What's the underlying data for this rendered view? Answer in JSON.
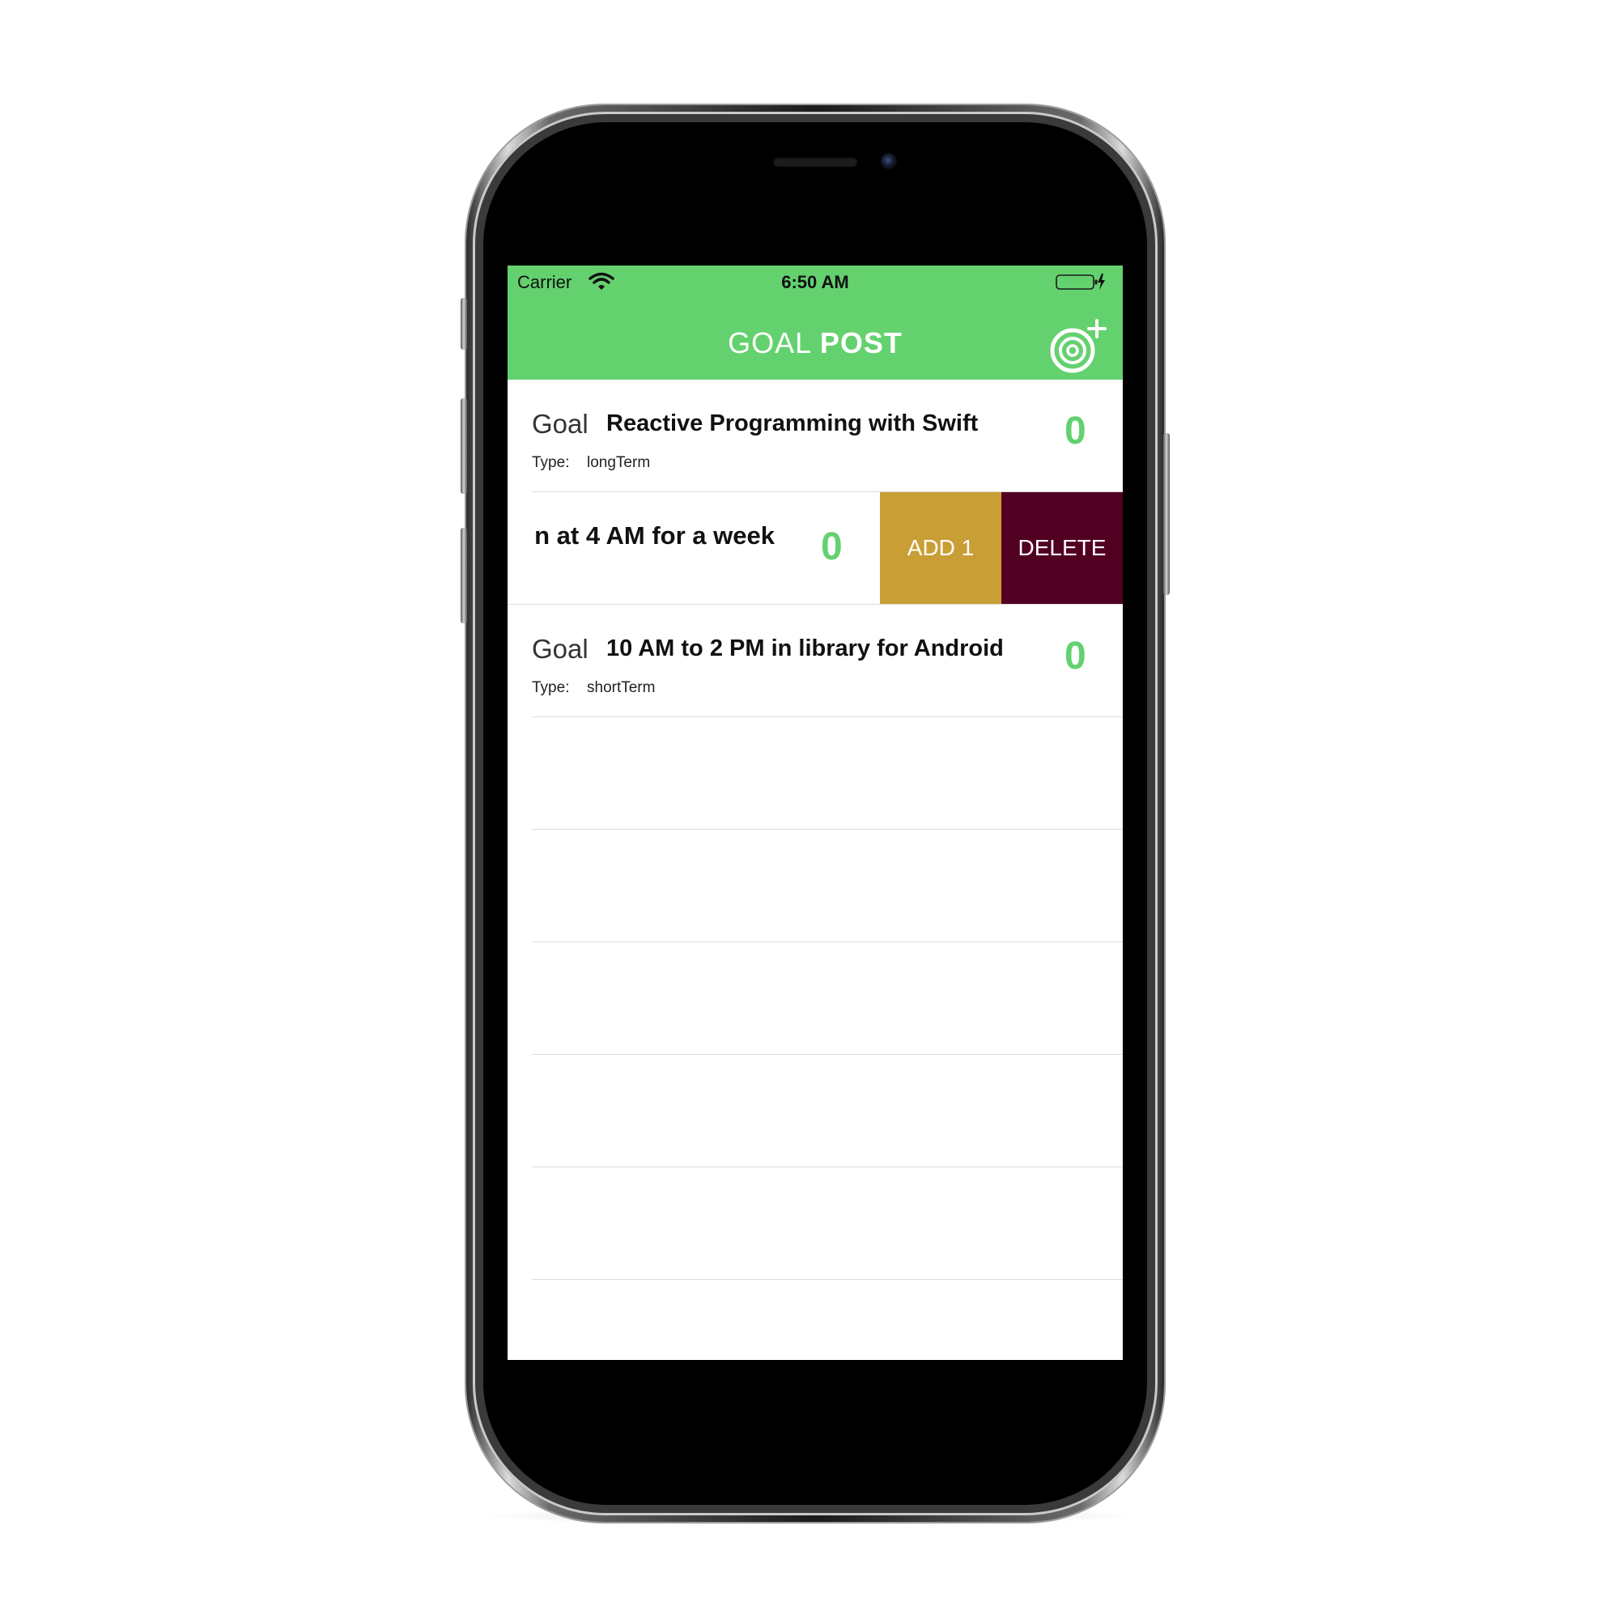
{
  "status_bar": {
    "carrier": "Carrier",
    "time": "6:50 AM",
    "wifi_icon": "wifi-icon",
    "battery_icon": "battery-charging-icon"
  },
  "header": {
    "title_light": "GOAL",
    "title_bold": "POST",
    "add_button_icon": "target-plus-icon",
    "background_color": "#64d16f"
  },
  "goals": [
    {
      "label": "Goal",
      "description": "Reactive Programming with Swift",
      "type_label": "Type:",
      "type": "longTerm",
      "progress": "0"
    },
    {
      "description_visible": "n at 4 AM for a week",
      "progress": "0",
      "actions": {
        "add_label": "ADD 1",
        "delete_label": "DELETE",
        "add_color": "#c99e36",
        "delete_color": "#520021"
      }
    },
    {
      "label": "Goal",
      "description": "10 AM to 2 PM in library for Android",
      "type_label": "Type:",
      "type": "shortTerm",
      "progress": "0"
    }
  ],
  "colors": {
    "accent": "#64d16f",
    "progress": "#64d16f"
  }
}
